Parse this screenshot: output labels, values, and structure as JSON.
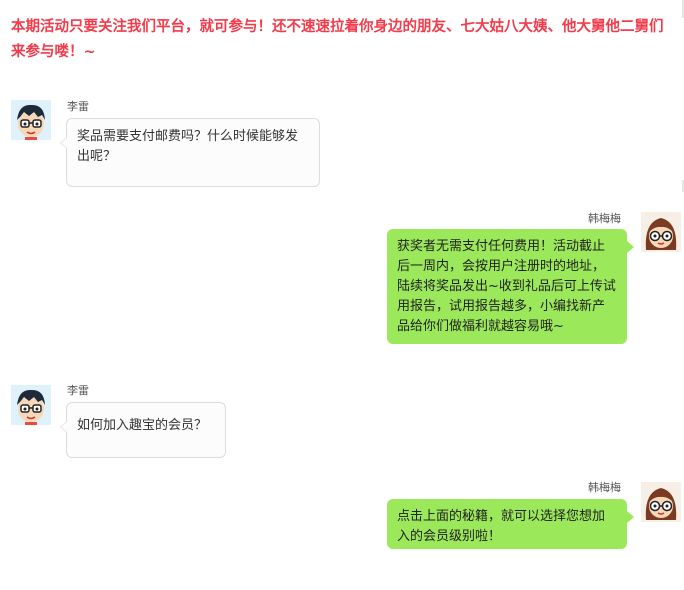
{
  "headline": "本期活动只要关注我们平台，就可参与！还不速速拉着你身边的朋友、七大姑八大姨、他大舅他二舅们来参与喽！~",
  "messages": [
    {
      "sender": "李雷",
      "text": "奖品需要支付邮费吗？什么时候能够发出呢？"
    },
    {
      "sender": "韩梅梅",
      "text": "获奖者无需支付任何费用！活动截止后一周内，会按用户注册时的地址，陆续将奖品发出~收到礼品后可上传试用报告，试用报告越多，小编找新产品给你们做福利就越容易哦~"
    },
    {
      "sender": "李雷",
      "text": "如何加入趣宝的会员？"
    },
    {
      "sender": "韩梅梅",
      "text": "点击上面的秘籍，就可以选择您想加入的会员级别啦！"
    }
  ]
}
